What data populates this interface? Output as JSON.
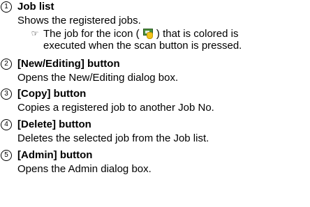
{
  "items": [
    {
      "number": "1",
      "title": "Job list",
      "desc": "Shows the registered jobs.",
      "note": {
        "icon": "pointing-hand-icon",
        "line1_before": "The job for the icon (",
        "line1_after": ") that is colored is",
        "line2": "executed when the scan button is pressed.",
        "inline_icon": "scan-job-icon"
      }
    },
    {
      "number": "2",
      "title": "[New/Editing] button",
      "desc": "Opens the New/Editing dialog box."
    },
    {
      "number": "3",
      "title": "[Copy] button",
      "desc": "Copies a registered job to another Job No."
    },
    {
      "number": "4",
      "title": "[Delete] button",
      "desc": "Deletes the selected job from the Job list."
    },
    {
      "number": "5",
      "title": "[Admin] button",
      "desc": "Opens the Admin dialog box."
    }
  ]
}
